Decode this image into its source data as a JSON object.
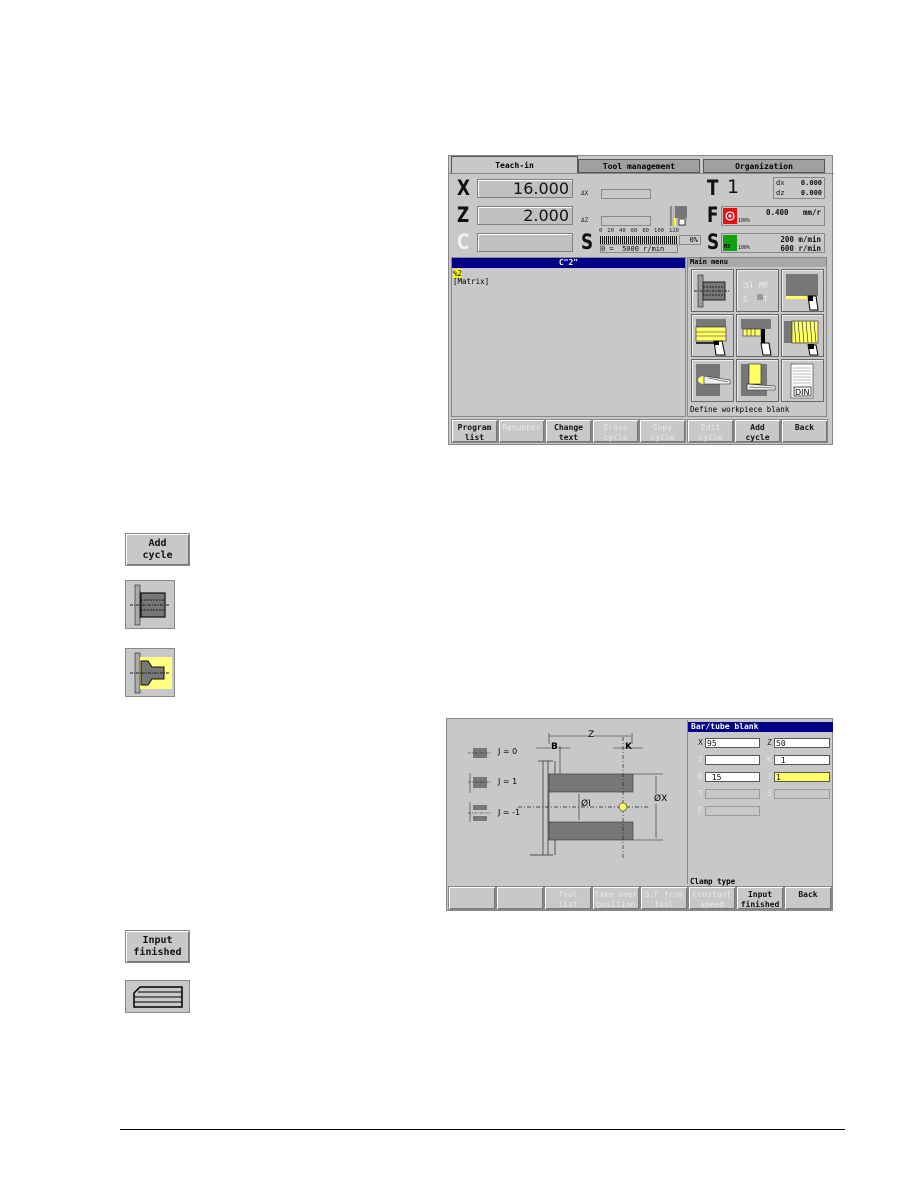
{
  "screen1": {
    "tabs": [
      {
        "label": "Teach-in",
        "active": true
      },
      {
        "label": "Tool management",
        "active": false
      },
      {
        "label": "Organization",
        "active": false
      }
    ],
    "axes": [
      {
        "letter": "X",
        "value": "16.000"
      },
      {
        "letter": "Z",
        "value": "2.000"
      },
      {
        "letter": "C",
        "value": ""
      }
    ],
    "delta_labels": [
      "ΔX",
      "ΔZ"
    ],
    "tool": {
      "letter": "T",
      "number": "1",
      "dx_label": "dx",
      "dx": "0.000",
      "dz_label": "dz",
      "dz": "0.000"
    },
    "feed": {
      "letter": "F",
      "value": "0.400",
      "unit": "mm/r",
      "override": "100%"
    },
    "spindle_load": {
      "letter": "S",
      "scale": [
        "0",
        "20",
        "40",
        "60",
        "80",
        "100",
        "120"
      ],
      "percent": "0%",
      "readout_prefix": "0 =",
      "readout": "5000 r/min"
    },
    "spindle": {
      "letter": "S",
      "speed1": "200 m/min",
      "speed2": "600 r/min",
      "override": "100%",
      "icon_label": "M3"
    },
    "program": {
      "title": "C\"2\"",
      "lines": [
        "%2",
        "[Matrix]"
      ]
    },
    "main_menu": {
      "title": "Main menu",
      "status": "Define workpiece blank"
    },
    "softkeys": [
      {
        "label": "Program\nlist",
        "enabled": true
      },
      {
        "label": "Renumber",
        "enabled": false
      },
      {
        "label": "Change\ntext",
        "enabled": true
      },
      {
        "label": "Erase\ncycle",
        "enabled": false
      },
      {
        "label": "Copy\ncycle",
        "enabled": false
      },
      {
        "label": "Edit\ncycle",
        "enabled": false
      },
      {
        "label": "Add\ncycle",
        "enabled": true
      },
      {
        "label": "Back",
        "enabled": true
      }
    ]
  },
  "side_buttons": {
    "add_cycle": "Add\ncycle",
    "input_finished": "Input\nfinished"
  },
  "screen2": {
    "legend": [
      "J = 0",
      "J = 1",
      "J = -1"
    ],
    "dims": {
      "z": "Z",
      "b": "B",
      "k": "K",
      "i": "ØI",
      "x": "ØX"
    },
    "panel_title": "Bar/tube blank",
    "fields": [
      {
        "label": "X",
        "value": "95",
        "state": "normal"
      },
      {
        "label": "Z",
        "value": "50",
        "state": "normal"
      },
      {
        "label": "I",
        "value": "",
        "state": "normal",
        "dim_label": true
      },
      {
        "label": "K",
        "value": " 1",
        "state": "normal",
        "dim_label": true
      },
      {
        "label": "B",
        "value": " 15",
        "state": "normal",
        "dim_label": true
      },
      {
        "label": "J",
        "value": "1",
        "state": "active",
        "dim_label": true
      },
      {
        "label": "T",
        "value": "",
        "state": "disabled",
        "dim_label": true
      },
      {
        "label": "S",
        "value": "",
        "state": "disabled",
        "dim_label": true
      },
      {
        "label": "F",
        "value": "",
        "state": "disabled",
        "dim_label": true
      }
    ],
    "status": "Clamp type",
    "softkeys": [
      {
        "label": "",
        "enabled": true
      },
      {
        "label": "",
        "enabled": true
      },
      {
        "label": "Tool\nlist",
        "enabled": false
      },
      {
        "label": "Take over\nposition",
        "enabled": false
      },
      {
        "label": "S,F from\ntool",
        "enabled": false
      },
      {
        "label": "Constant\nspeed",
        "enabled": false
      },
      {
        "label": "Input\nfinished",
        "enabled": true
      },
      {
        "label": "Back",
        "enabled": true
      }
    ]
  },
  "colors": {
    "screen_bg": "#c8c8c8",
    "titlebar": "#000088",
    "highlight_yellow": "#ffff66",
    "feed_icon_red": "#e01010",
    "spindle_icon_green": "#10a010"
  }
}
